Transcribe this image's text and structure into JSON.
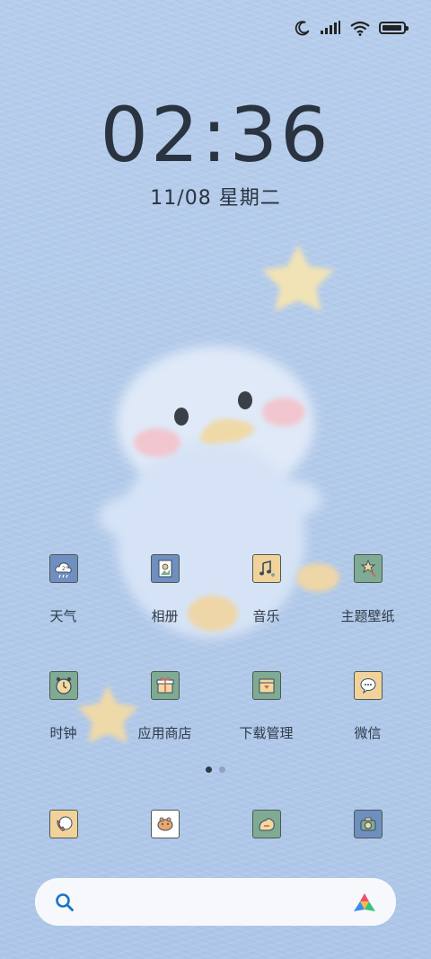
{
  "status_bar": {
    "icons": [
      "moon-icon",
      "signal-icon",
      "wifi-icon",
      "battery-icon"
    ],
    "battery_level": 0.95
  },
  "lock": {
    "time": "02:36",
    "date": "11/08 星期二"
  },
  "apps_row1": [
    {
      "label": "天气",
      "icon": "weather-icon",
      "bg": "#6f8fc0"
    },
    {
      "label": "相册",
      "icon": "gallery-icon",
      "bg": "#6f8fc0"
    },
    {
      "label": "音乐",
      "icon": "music-icon",
      "bg": "#f1d29b"
    },
    {
      "label": "主题壁纸",
      "icon": "themes-icon",
      "bg": "#7faa94"
    }
  ],
  "apps_row2": [
    {
      "label": "时钟",
      "icon": "clock-icon",
      "bg": "#7faa94"
    },
    {
      "label": "应用商店",
      "icon": "app-store-icon",
      "bg": "#7faa94"
    },
    {
      "label": "下载管理",
      "icon": "download-icon",
      "bg": "#7faa94"
    },
    {
      "label": "微信",
      "icon": "wechat-icon",
      "bg": "#f1d29b"
    }
  ],
  "pager": {
    "pages": 2,
    "current": 1
  },
  "dock": [
    {
      "icon": "phone-icon",
      "bg": "#f1d29b"
    },
    {
      "icon": "messages-icon",
      "bg": "#ffffff"
    },
    {
      "icon": "browser-icon",
      "bg": "#7faa94"
    },
    {
      "icon": "camera-icon",
      "bg": "#6f8fc0"
    }
  ],
  "search": {
    "placeholder": "",
    "icon": "search-icon",
    "assistant_icon": "assistant-logo-icon"
  },
  "colors": {
    "wallpaper": "#b3cbea",
    "text": "#2e3a48"
  }
}
